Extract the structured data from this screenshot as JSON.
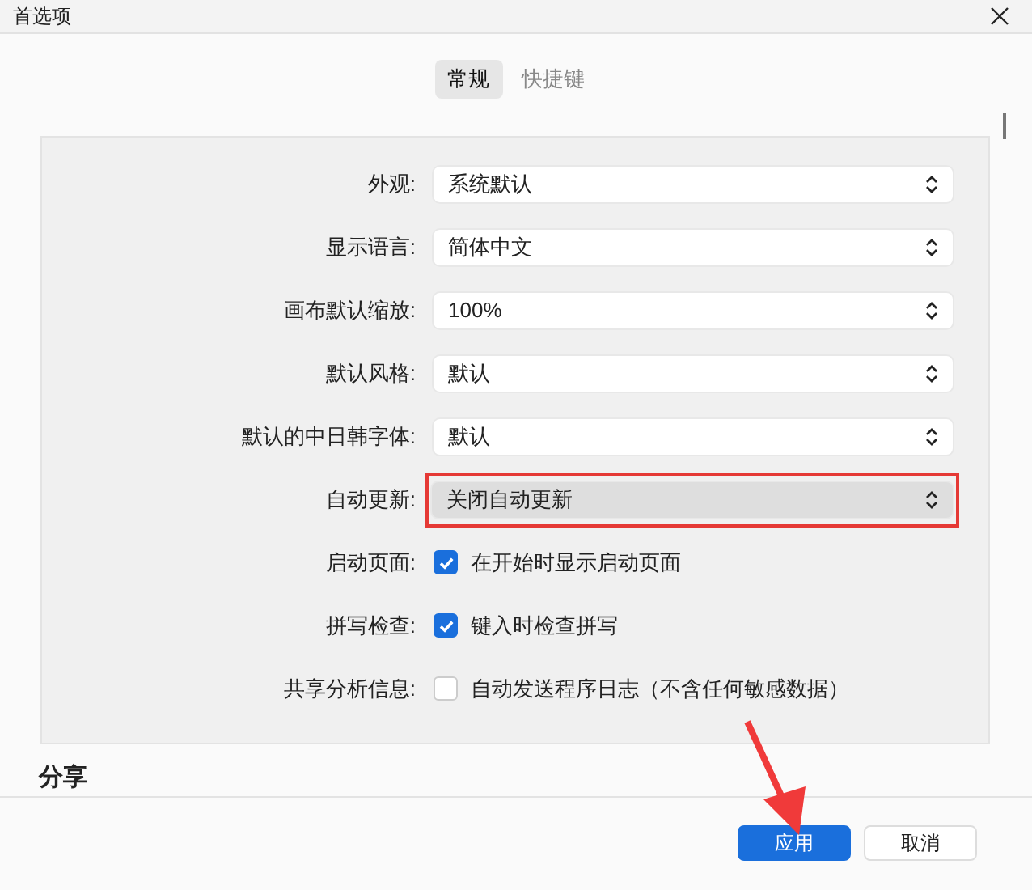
{
  "window": {
    "title": "首选项"
  },
  "tabs": [
    {
      "label": "常规",
      "selected": true
    },
    {
      "label": "快捷键",
      "selected": false
    }
  ],
  "settings": [
    {
      "kind": "select",
      "label": "外观:",
      "value": "系统默认",
      "highlighted": false
    },
    {
      "kind": "select",
      "label": "显示语言:",
      "value": "简体中文",
      "highlighted": false
    },
    {
      "kind": "select",
      "label": "画布默认缩放:",
      "value": "100%",
      "highlighted": false
    },
    {
      "kind": "select",
      "label": "默认风格:",
      "value": "默认",
      "highlighted": false
    },
    {
      "kind": "select",
      "label": "默认的中日韩字体:",
      "value": "默认",
      "highlighted": false
    },
    {
      "kind": "select",
      "label": "自动更新:",
      "value": "关闭自动更新",
      "highlighted": true
    },
    {
      "kind": "checkbox",
      "label": "启动页面:",
      "value": "在开始时显示启动页面",
      "checked": true
    },
    {
      "kind": "checkbox",
      "label": "拼写检查:",
      "value": "键入时检查拼写",
      "checked": true
    },
    {
      "kind": "checkbox",
      "label": "共享分析信息:",
      "value": "自动发送程序日志（不含任何敏感数据）",
      "checked": false
    }
  ],
  "section": {
    "title": "分享"
  },
  "buttons": [
    {
      "label": "应用",
      "kind": "primary"
    },
    {
      "label": "取消",
      "kind": "secondary"
    }
  ]
}
